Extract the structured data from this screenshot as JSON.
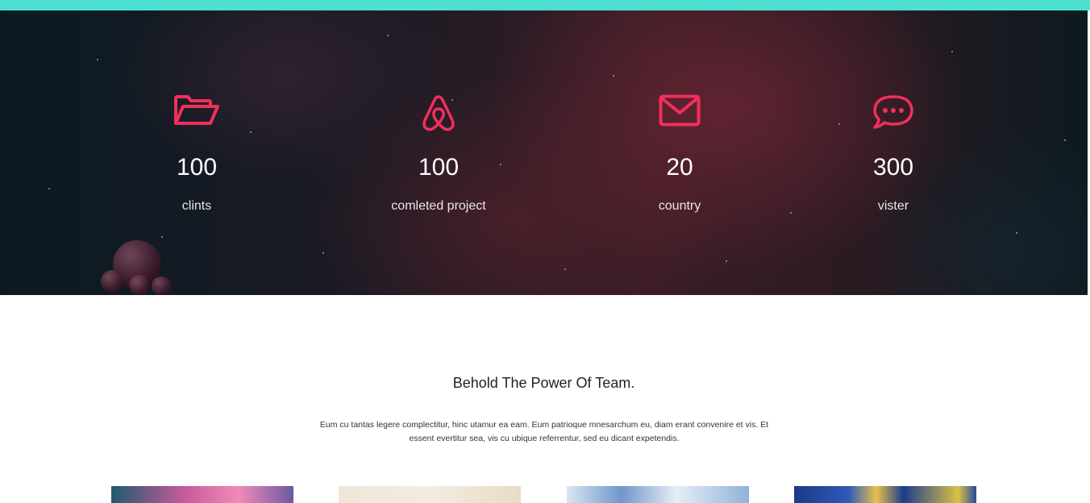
{
  "stats": [
    {
      "icon": "folder-open-icon",
      "number": "100",
      "label": "clints"
    },
    {
      "icon": "airbnb-icon",
      "number": "100",
      "label": "comleted project"
    },
    {
      "icon": "envelope-icon",
      "number": "20",
      "label": "country"
    },
    {
      "icon": "chat-bubble-icon",
      "number": "300",
      "label": "vister"
    }
  ],
  "team": {
    "title": "Behold The Power Of Team.",
    "description": "Eum cu tantas legere complectitur, hinc utamur ea eam. Eum patrioque mnesarchum eu, diam erant convenire et vis. Et essent evertitur sea, vis cu ubique referrentur, sed eu dicant expetendis."
  },
  "colors": {
    "accent_bar": "#4ddfcf",
    "icon_color": "#f0305a"
  }
}
